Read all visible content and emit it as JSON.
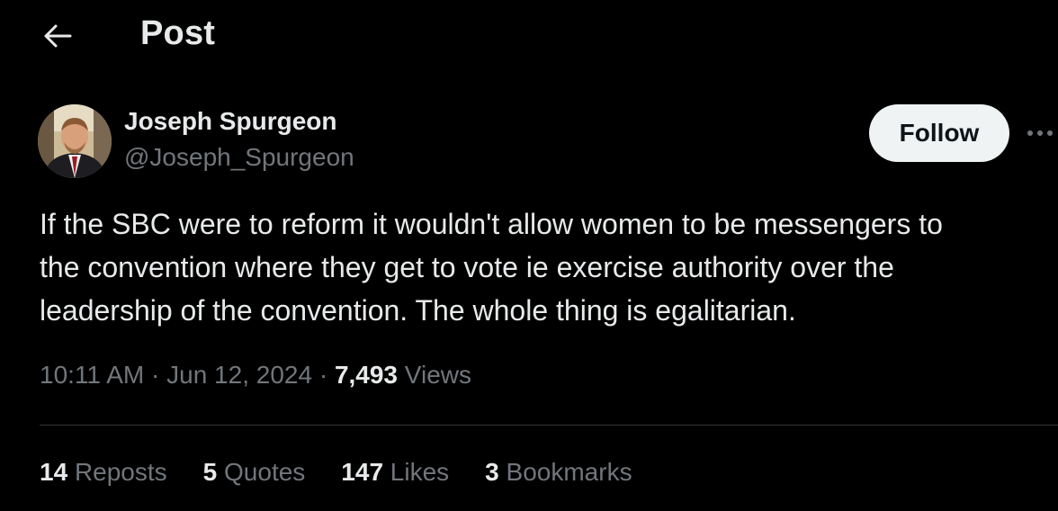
{
  "header": {
    "title": "Post",
    "back_icon": "arrow-left-icon"
  },
  "author": {
    "display_name": "Joseph Spurgeon",
    "handle": "@Joseph_Spurgeon",
    "avatar": "profile-photo"
  },
  "actions": {
    "follow_label": "Follow",
    "more_icon": "more-horizontal-icon"
  },
  "post": {
    "text": "If the SBC were to reform it wouldn't allow women to be messengers to\nthe convention where they get to vote ie exercise authority over the\nleadership of the convention.  The whole thing is egalitarian.",
    "time": "10:11 AM",
    "separator": "·",
    "date": "Jun 12, 2024",
    "views_count": "7,493",
    "views_label": "Views"
  },
  "stats": [
    {
      "count": "14",
      "label": "Reposts"
    },
    {
      "count": "5",
      "label": "Quotes"
    },
    {
      "count": "147",
      "label": "Likes"
    },
    {
      "count": "3",
      "label": "Bookmarks"
    }
  ],
  "colors": {
    "background": "#000000",
    "primary_text": "#e7e9ea",
    "secondary_text": "#71767b",
    "follow_button_bg": "#eff3f4",
    "divider": "#2f3336"
  }
}
